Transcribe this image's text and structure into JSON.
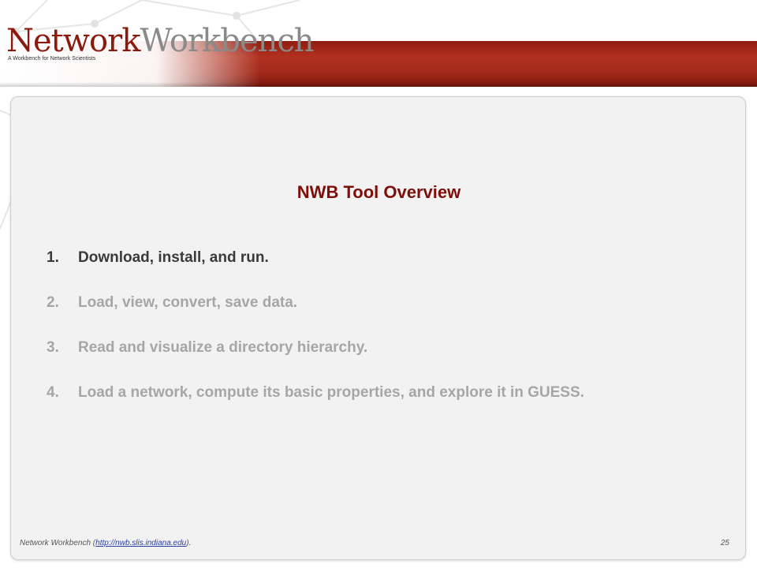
{
  "logo": {
    "word1": "Network",
    "word2": "Workbench",
    "tagline": "A Workbench for Network Scientists"
  },
  "slide": {
    "title": "NWB Tool Overview",
    "items": [
      {
        "num": "1.",
        "text": "Download, install, and run.",
        "active": true
      },
      {
        "num": "2.",
        "text": "Load, view, convert, save data.",
        "active": false
      },
      {
        "num": "3.",
        "text": "Read and visualize a directory hierarchy.",
        "active": false
      },
      {
        "num": "4.",
        "text": "Load a network, compute its basic properties, and explore it in GUESS.",
        "active": false
      }
    ]
  },
  "footer": {
    "prefix": "Network Workbench (",
    "link": "http://nwb.slis.indiana.edu",
    "suffix": ").",
    "page": "25"
  },
  "colors": {
    "brand_red": "#8b1a0e",
    "title_red": "#7d0f0a",
    "active_text": "#3a3a3a",
    "inactive_text": "#a6a6a6"
  }
}
